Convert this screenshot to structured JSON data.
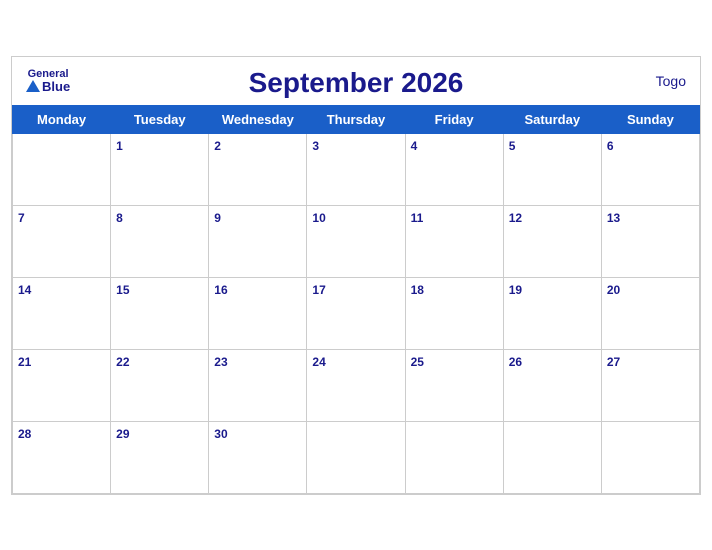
{
  "calendar": {
    "title": "September 2026",
    "country": "Togo",
    "logo": {
      "general": "General",
      "blue": "Blue"
    },
    "days_of_week": [
      "Monday",
      "Tuesday",
      "Wednesday",
      "Thursday",
      "Friday",
      "Saturday",
      "Sunday"
    ],
    "weeks": [
      [
        null,
        1,
        2,
        3,
        4,
        5,
        6
      ],
      [
        7,
        8,
        9,
        10,
        11,
        12,
        13
      ],
      [
        14,
        15,
        16,
        17,
        18,
        19,
        20
      ],
      [
        21,
        22,
        23,
        24,
        25,
        26,
        27
      ],
      [
        28,
        29,
        30,
        null,
        null,
        null,
        null
      ]
    ]
  }
}
